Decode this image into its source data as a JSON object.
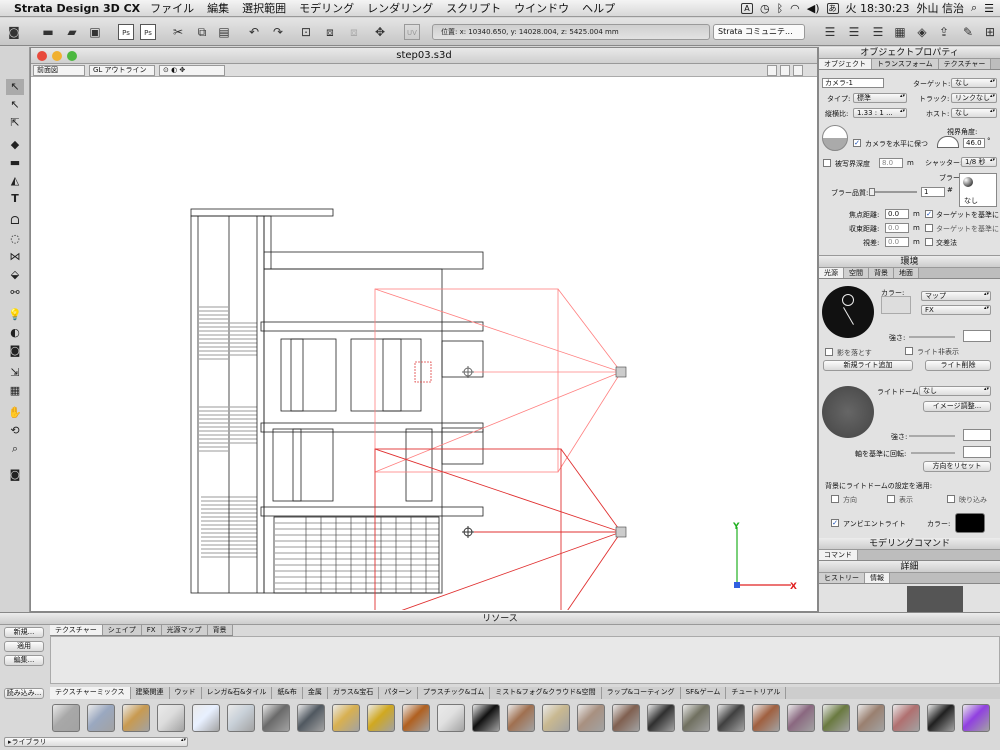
{
  "menubar": {
    "app": "Strata Design 3D CX",
    "items": [
      "ファイル",
      "編集",
      "選択範囲",
      "モデリング",
      "レンダリング",
      "スクリプト",
      "ウインドウ",
      "ヘルプ"
    ],
    "ime": "あ",
    "time": "火 18:30:23",
    "user": "外山 信治"
  },
  "toolbar": {
    "coords": "位置: x: 10340.650, y: 14028.004, z: 5425.004 mm",
    "community": "Strata コミュニテ..."
  },
  "document": {
    "title": "step03.s3d",
    "view": "前面図",
    "render_mode": "GL アウトライン"
  },
  "axes": {
    "x": "X",
    "y": "Y",
    "x_color": "#e02020",
    "y_color": "#20b020"
  },
  "object_props": {
    "title": "オブジェクトプロパティ",
    "tabs": [
      "オブジェクト",
      "トランスフォーム",
      "テクスチャー"
    ],
    "name": "カメラ-1",
    "target_label": "ターゲット:",
    "target_val": "なし",
    "type_label": "タイプ:",
    "type_val": "標準",
    "track_label": "トラック:",
    "track_val": "リンクなし",
    "aspect_label": "縦横比:",
    "aspect_val": "1.33 : 1 ...",
    "host_label": "ホスト:",
    "host_val": "なし",
    "fov_label": "視界角度:",
    "fov_val": "46.0",
    "level_label": "カメラを水平に保つ",
    "dof_label": "被写界深度",
    "dof_val": "8.0",
    "m": "m",
    "shutter_label": "シャッター:",
    "shutter_val": "1/8 秒",
    "blur_label": "ブラー:",
    "blur_none": "なし",
    "blurq_label": "ブラー品質:",
    "blurq_val": "1",
    "hash": "#",
    "focal_label": "焦点距離:",
    "focal_val": "0.0",
    "conv_label": "収束距離:",
    "conv_val": "0.0",
    "disp_label": "視差:",
    "disp_val": "0.0",
    "tgt1": "ターゲットを基準に",
    "tgt2": "ターゲットを基準に",
    "cross": "交差法"
  },
  "environment": {
    "title": "環境",
    "tabs": [
      "光源",
      "空間",
      "背景",
      "地面"
    ],
    "color_label": "カラー:",
    "map_val": "マップ",
    "fx_val": "FX",
    "strength_label": "強さ:",
    "shadow_label": "影を落とす",
    "hide_label": "ライト非表示",
    "new_light": "新規ライト追加",
    "del_light": "ライト削除",
    "dome_label": "ライトドーム:",
    "dome_val": "なし",
    "image_adj": "イメージ調整...",
    "strength2": "強さ:",
    "rotate_label": "軸を基準に回転:",
    "reset": "方向をリセット",
    "bg_apply": "背景にライトドームの設定を適用:",
    "dir": "方向",
    "show": "表示",
    "reflect": "映り込み",
    "ambient": "アンビエントライト",
    "ambient_color": "カラー:"
  },
  "modeling": {
    "title": "モデリングコマンド",
    "command": "コマンド",
    "detail": "詳細",
    "history": "ヒストリー",
    "info": "情報"
  },
  "resources": {
    "title": "リソース",
    "new": "新規...",
    "apply": "適用",
    "edit": "編集...",
    "load": "読み込み...",
    "tabs": [
      "テクスチャー",
      "シェイプ",
      "FX",
      "光源マップ",
      "背景"
    ],
    "categories": [
      "テクスチャーミックス",
      "建築関連",
      "ウッド",
      "レンガ&石&タイル",
      "紙&布",
      "金属",
      "ガラス&宝石",
      "パターン",
      "プラスチック&ゴム",
      "ミスト&フォグ&クラウド&空間",
      "ラップ&コーティング",
      "SF&ゲーム",
      "チュートリアル"
    ],
    "library": "▸ライブラリ"
  },
  "swatch_colors": [
    "#a8a8a8",
    "#9aa8c0",
    "#c89a50",
    "#dcdcdc",
    "#e8f0ff",
    "#c8d0d8",
    "#6a6a6a",
    "#505860",
    "#d8b050",
    "#d0a820",
    "#b06020",
    "#e0e0e0",
    "#111111",
    "#a07050",
    "#c8b890",
    "#a89080",
    "#806050",
    "#303030",
    "#707060",
    "#404040",
    "#a06040",
    "#8a6880",
    "#6a7a40",
    "#9a8070",
    "#b07070",
    "#202020",
    "#9040e0"
  ]
}
